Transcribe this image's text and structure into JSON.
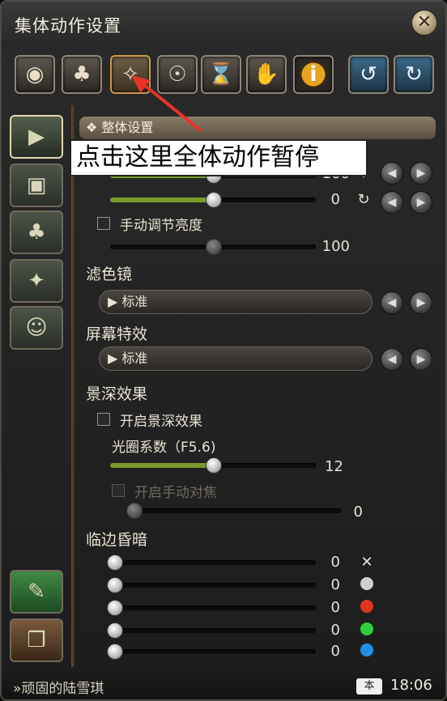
{
  "window": {
    "title": "集体动作设置",
    "close_icon": "close-icon"
  },
  "toolbar": [
    {
      "icon": "eye-icon",
      "glyph": "◉"
    },
    {
      "icon": "lamp-icon",
      "glyph": "♣"
    },
    {
      "icon": "pose-pause-icon",
      "glyph": "✧",
      "selected": true
    },
    {
      "icon": "pose-icon",
      "glyph": "☉"
    },
    {
      "icon": "timer-lock-icon",
      "glyph": "⌛"
    },
    {
      "icon": "gesture-icon",
      "glyph": "✋"
    },
    {
      "icon": "info-icon",
      "glyph": "i"
    },
    {
      "icon": "rotate-left-icon",
      "glyph": "↺"
    },
    {
      "icon": "rotate-right-icon",
      "glyph": "↻"
    }
  ],
  "annotation": {
    "tooltip": "点击这里全体动作暂停"
  },
  "sidebar": [
    {
      "icon": "camera-settings-icon",
      "glyph": "▶",
      "selected": true
    },
    {
      "icon": "frame-icon",
      "glyph": "▣"
    },
    {
      "icon": "light-icon",
      "glyph": "♣"
    },
    {
      "icon": "running-person-icon",
      "glyph": "✦"
    },
    {
      "icon": "two-people-icon",
      "glyph": "☺"
    },
    {
      "icon": "feather-book-icon",
      "glyph": "✎"
    },
    {
      "icon": "open-book-icon",
      "glyph": "❒"
    }
  ],
  "panel": {
    "section_title": "❖ 整体设置",
    "slider1_value": "100",
    "slider2_value": "0",
    "manual_brightness_label": "手动调节亮度",
    "brightness_value": "100",
    "filter_label": "滤色镜",
    "filter_value": "▶ 标准",
    "effect_label": "屏幕特效",
    "effect_value": "▶ 标准",
    "dof_label": "景深效果",
    "dof_enable_label": "开启景深效果",
    "aperture_label": "光圈系数（F5.6)",
    "aperture_value": "12",
    "manual_focus_label": "开启手动对焦",
    "focus_value": "0",
    "vignette_label": "临边昏暗",
    "vignette_values": [
      "0",
      "0",
      "0",
      "0",
      "0"
    ],
    "vignette_colors": [
      "#ffffff",
      "#cfcfcf",
      "#e0361e",
      "#2ecf39",
      "#1f8fe8"
    ]
  },
  "footer": {
    "player_name": "»顽固的陆雪琪",
    "badge": "本",
    "time": "18:06"
  }
}
